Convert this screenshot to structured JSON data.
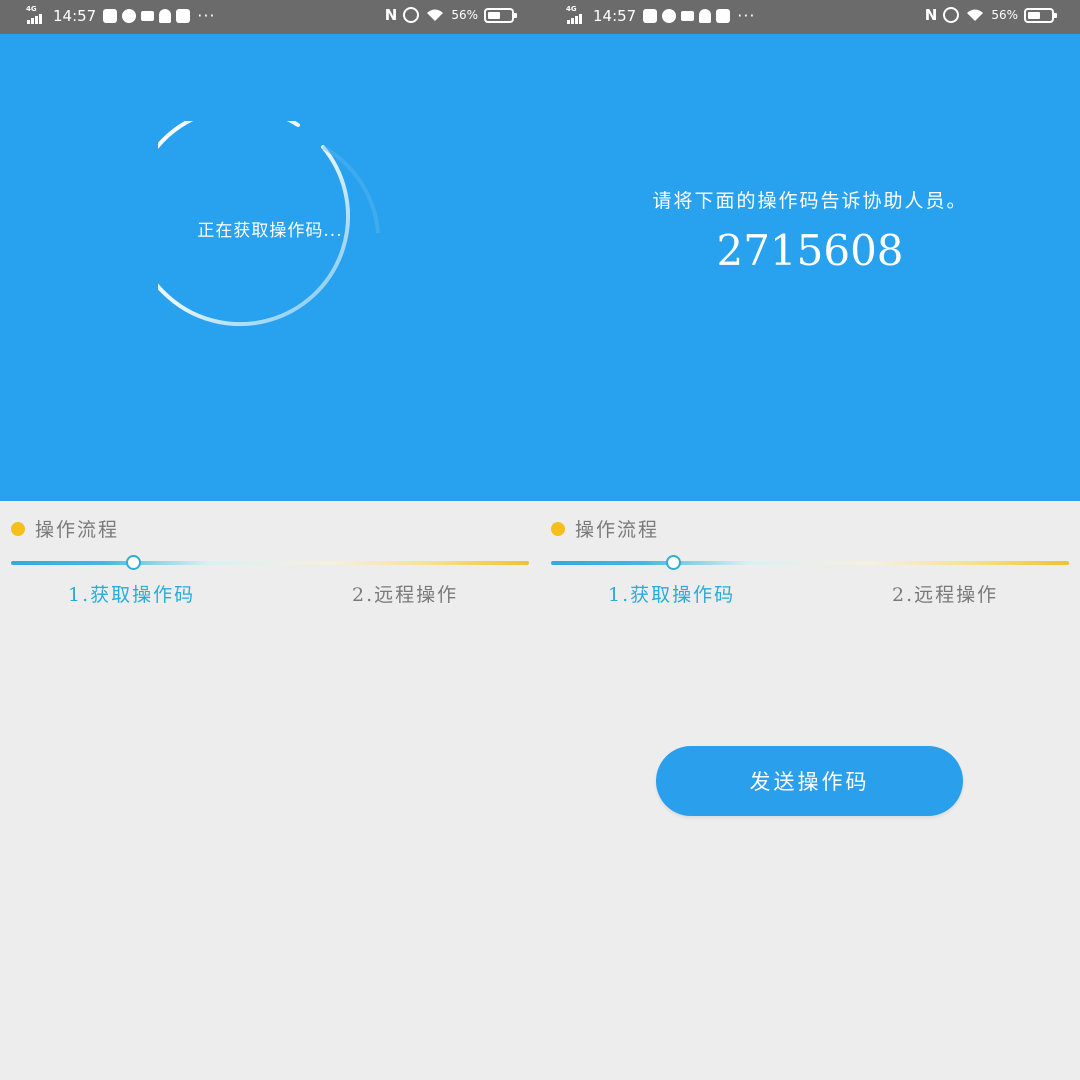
{
  "status_bar": {
    "network": "4G",
    "time": "14:57",
    "battery_percent": "56%",
    "battery_level": 0.56,
    "left_icons": [
      "sim-signal-icon",
      "notification-app-icon",
      "compass-app-icon",
      "video-icon",
      "qq-penguin-icon",
      "notification-app-icon",
      "more-dots-icon"
    ],
    "right_icons": [
      "nfc-icon",
      "alarm-clock-icon",
      "wifi-icon",
      "battery-icon"
    ],
    "more": "···",
    "nfc": "N"
  },
  "left_screen": {
    "loading_text": "正在获取操作码...",
    "spinner_colors": [
      "#ffffff",
      "#28a1ef"
    ]
  },
  "right_screen": {
    "instruction": "请将下面的操作码告诉协助人员。",
    "operation_code": "2715608",
    "send_button_label": "发送操作码"
  },
  "workflow": {
    "title": "操作流程",
    "steps": [
      {
        "label": "1.获取操作码",
        "active": true
      },
      {
        "label": "2.远程操作",
        "active": false
      }
    ],
    "progress_fraction": 0.24
  },
  "colors": {
    "hero_blue": "#28a1ef",
    "accent_yellow": "#f5c01a",
    "active_step": "#29acd7",
    "inactive_text": "#7a7a7a",
    "background": "#ededed"
  }
}
